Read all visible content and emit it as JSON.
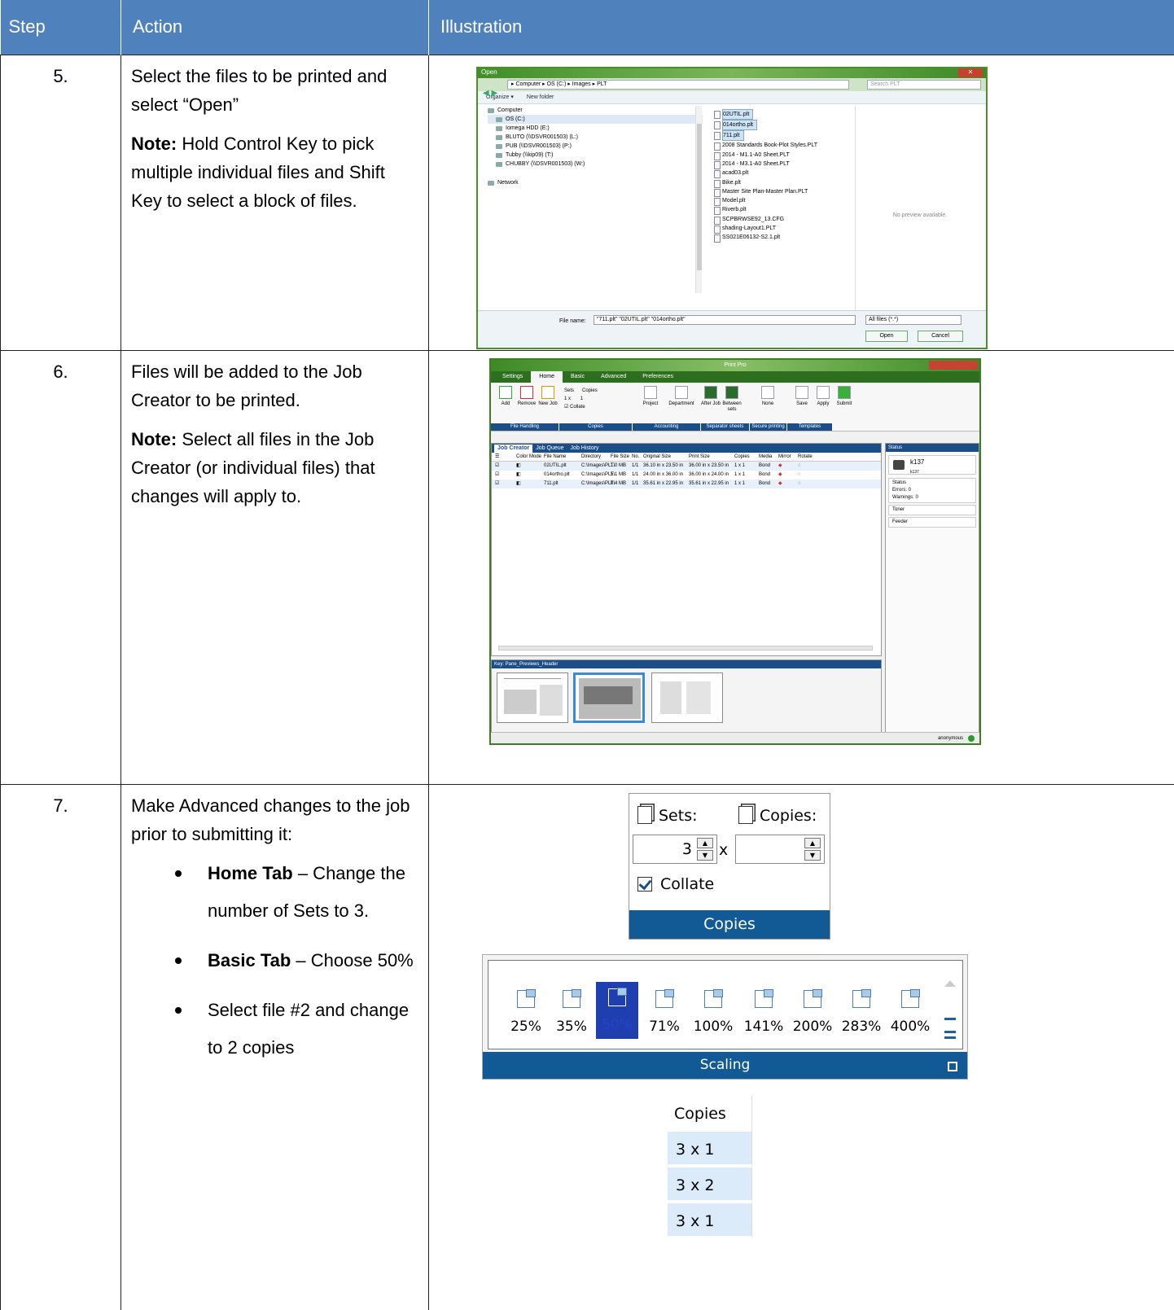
{
  "columns": {
    "step": "Step",
    "action": "Action",
    "illustration": "Illustration"
  },
  "rows": [
    {
      "step": "5.",
      "text": "Select the files to be printed and select “Open”",
      "note_label": "Note:",
      "note_text": " Hold Control Key to pick multiple individual files and Shift Key to select a block of files."
    },
    {
      "step": "6.",
      "text": "Files will be added to the Job Creator to be printed.",
      "note_label": "Note:",
      "note_text": " Select all files in the Job Creator (or individual files) that changes will apply to."
    },
    {
      "step": "7.",
      "text": "Make Advanced changes to the job prior to submitting it:",
      "bullets": [
        {
          "bold": "Home Tab",
          "text": " – Change the number of Sets to 3."
        },
        {
          "bold": "Basic Tab",
          "text": " – Choose 50%"
        },
        {
          "bold": "",
          "text": "Select file #2 and change to 2 copies"
        }
      ]
    }
  ],
  "open_dialog": {
    "title": "Open",
    "path": "▸ Computer ▸ OS (C:) ▸ Images ▸ PLT",
    "search_placeholder": "Search PLT",
    "organize": "Organize ▾",
    "new_folder": "New folder",
    "tree": [
      "Computer",
      "OS (C:)",
      "Iomega HDD (E:)",
      "BLUTO (\\\\DSVR001503) (L:)",
      "PUB (\\\\DSVR001503) (P:)",
      "Tubby (\\\\kip09) (T:)",
      "CHUBBY (\\\\DSVR001503) (W:)",
      "Network"
    ],
    "files": [
      "02UTIL.plt",
      "014ortho.plt",
      "711.plt",
      "2008 Standards Book-Plot Styles.PLT",
      "2014 - M1.1-A0 Sheet.PLT",
      "2014 - M3.1-A0 Sheet.PLT",
      "acad03.plt",
      "Bike.plt",
      "Master Site Plan-Master Plan.PLT",
      "Model.plt",
      "Riverb.plt",
      "SCPBRWSE92_13.CFG",
      "shading-Layout1.PLT",
      "SS021E06132-S2.1.plt"
    ],
    "preview_text": "No preview available.",
    "file_name_label": "File name:",
    "file_name_value": "\"711.plt\" \"02UTIL.plt\" \"014ortho.plt\"",
    "file_type": "All files (*.*)",
    "open_button": "Open",
    "cancel_button": "Cancel"
  },
  "print_pro": {
    "title": "Print Pro",
    "tabs": [
      "Settings",
      "Home",
      "Basic",
      "Advanced",
      "Preferences"
    ],
    "ribbon_buttons": [
      "Add",
      "Remove",
      "New Job",
      "Project",
      "Department",
      "After Job",
      "Between sets",
      "None",
      "Save",
      "Apply",
      "Submit"
    ],
    "sets_label": "Sets",
    "copies_label": "Copies",
    "sets_value": "1",
    "copies_value": "1",
    "collate_label": "Collate",
    "groups": [
      "File Handling",
      "Copies",
      "Accounting",
      "Separator sheets",
      "Secure printing",
      "Templates"
    ],
    "job_tabs": [
      "Job Creator",
      "Job Queue",
      "Job History"
    ],
    "columns": [
      "Color Mode",
      "File Name",
      "Directory",
      "File Size",
      "No.",
      "Original Size",
      "Print Size",
      "Copies",
      "Media",
      "Mirror",
      "Rotate"
    ],
    "jobs": [
      {
        "name": "02UTIL.plt",
        "dir": "C:\\Images\\PLT\\",
        "size": "1.0 MB",
        "no": "1/1",
        "orig": "36.10 in x 23.50 in",
        "print": "36.00 in x 23.50 in",
        "copies": "1 x 1",
        "media": "Bond"
      },
      {
        "name": "014ortho.plt",
        "dir": "C:\\Images\\PLT\\",
        "size": "5.1 MB",
        "no": "1/1",
        "orig": "24.00 in x 36.00 in",
        "print": "36.00 in x 24.00 in",
        "copies": "1 x 1",
        "media": "Bond"
      },
      {
        "name": "711.plt",
        "dir": "C:\\Images\\PLT\\",
        "size": "0.4 MB",
        "no": "1/1",
        "orig": "35.61 in x 22.95 in",
        "print": "35.61 in x 22.95 in",
        "copies": "1 x 1",
        "media": "Bond"
      }
    ],
    "preview_header": "Key: Pane_Previews_Header",
    "status_header": "Status",
    "printer_name": "k137",
    "printer_sub": "k137",
    "status_section": "Status",
    "errors_label": "Errors:",
    "errors_value": "0",
    "warnings_label": "Warnings:",
    "warnings_value": "0",
    "toner": "Toner",
    "feeder": "Feeder",
    "user": "anonymous"
  },
  "copies_panel": {
    "sets_label": "Sets:",
    "copies_label": "Copies:",
    "sets_value": "3",
    "x": "x",
    "collate": "Collate",
    "footer": "Copies"
  },
  "scaling_panel": {
    "options": [
      "25%",
      "35%",
      "50%",
      "71%",
      "100%",
      "141%",
      "200%",
      "283%",
      "400%"
    ],
    "selected": "50%",
    "footer": "Scaling"
  },
  "copies_column": {
    "header": "Copies",
    "values": [
      "3 x 1",
      "3 x 2",
      "3 x 1"
    ]
  },
  "colors": {
    "header_bg": "#4f81bd",
    "ribbon_blue": "#115a96",
    "selected": "#1f3fb0"
  }
}
